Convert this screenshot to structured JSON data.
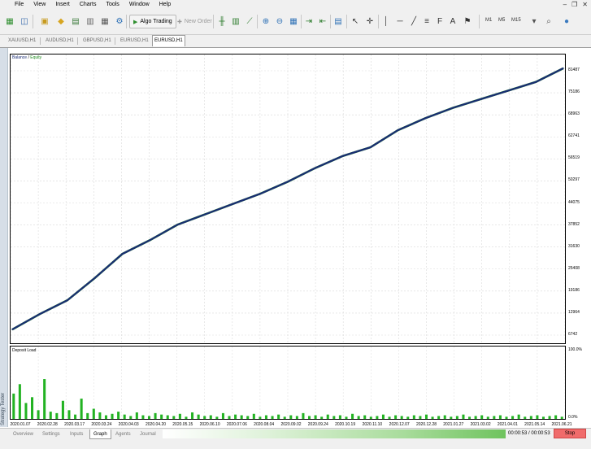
{
  "menu": [
    "File",
    "View",
    "Insert",
    "Charts",
    "Tools",
    "Window",
    "Help"
  ],
  "toolbar": {
    "algo_trading": "Algo Trading",
    "new_order": "New Order",
    "timeframes": [
      "M1",
      "M5",
      "M15"
    ]
  },
  "symbol_tabs": [
    "XAUUSD,H1",
    "AUDUSD,H1",
    "GBPUSD,H1",
    "EURUSD,H1",
    "EURUSD,H1"
  ],
  "side_strip": "Strategy Tester",
  "balance_chart": {
    "legend_balance": "Balance",
    "legend_equity": "Equity",
    "y_ticks": [
      "81487",
      "75186",
      "68963",
      "62741",
      "56519",
      "50297",
      "44075",
      "37852",
      "31630",
      "25408",
      "19186",
      "12964",
      "6742"
    ]
  },
  "load_chart": {
    "title": "Deposit Load",
    "y_top": "100.0%",
    "y_bottom": "0.0%"
  },
  "x_dates": [
    "2020.01.07",
    "2020.02.28",
    "2020.03.17",
    "2020.03.24",
    "2020.04.03",
    "2020.04.20",
    "2020.05.15",
    "2020.06.10",
    "2020.07.06",
    "2020.08.04",
    "2020.09.02",
    "2020.09.24",
    "2020.10.19",
    "2020.11.10",
    "2020.12.07",
    "2020.12.28",
    "2021.01.27",
    "2021.03.02",
    "2021.04.01",
    "2021.05.14",
    "2021.06.21"
  ],
  "chart_data": {
    "type": "line",
    "series": [
      {
        "name": "Balance",
        "color": "#1a2c74",
        "values": [
          4000,
          8500,
          12500,
          19000,
          26000,
          30000,
          34500,
          37500,
          40500,
          43500,
          47000,
          51000,
          54500,
          57000,
          62000,
          65500,
          68500,
          71000,
          73500,
          76000,
          80000
        ]
      },
      {
        "name": "Equity",
        "color": "#1e8a1e",
        "values": [
          4000,
          8500,
          12500,
          19000,
          26000,
          30000,
          34500,
          37500,
          40500,
          43500,
          47000,
          51000,
          54500,
          57000,
          62000,
          65500,
          68500,
          71000,
          73500,
          76000,
          80000
        ]
      }
    ],
    "categories": [
      "2020.01.07",
      "2020.02.28",
      "2020.03.17",
      "2020.03.24",
      "2020.04.03",
      "2020.04.20",
      "2020.05.15",
      "2020.06.10",
      "2020.07.06",
      "2020.08.04",
      "2020.09.02",
      "2020.09.24",
      "2020.10.19",
      "2020.11.10",
      "2020.12.07",
      "2020.12.28",
      "2021.01.27",
      "2021.03.02",
      "2021.04.01",
      "2021.05.14",
      "2021.06.21"
    ],
    "ylim": [
      0,
      84000
    ],
    "grid": true
  },
  "deposit_load_data": {
    "type": "bar",
    "ylim": [
      0,
      100
    ],
    "values": [
      35,
      48,
      22,
      30,
      12,
      55,
      10,
      8,
      25,
      12,
      6,
      28,
      8,
      14,
      9,
      5,
      7,
      10,
      6,
      4,
      9,
      5,
      4,
      8,
      6,
      5,
      4,
      7,
      3,
      9,
      6,
      4,
      5,
      3,
      8,
      4,
      6,
      5,
      4,
      7,
      3,
      5,
      4,
      6,
      3,
      5,
      4,
      8,
      4,
      5,
      3,
      6,
      4,
      5,
      3,
      7,
      4,
      5,
      3,
      4,
      6,
      3,
      5,
      4,
      3,
      5,
      4,
      6,
      3,
      4,
      5,
      3,
      4,
      6,
      3,
      4,
      5,
      3,
      4,
      5,
      3,
      4,
      6,
      3,
      4,
      5,
      3,
      4,
      5,
      3
    ]
  },
  "bottom_tabs": [
    "Overview",
    "Settings",
    "Inputs",
    "Graph",
    "Agents",
    "Journal"
  ],
  "progress": 1.0,
  "timer": "00:00:53 / 00:00:53",
  "stop_label": "Stop",
  "colors": {
    "balance": "#1a2c74",
    "equity": "#1e8a1e",
    "load": "#22b222",
    "stop": "#f06b6b"
  }
}
